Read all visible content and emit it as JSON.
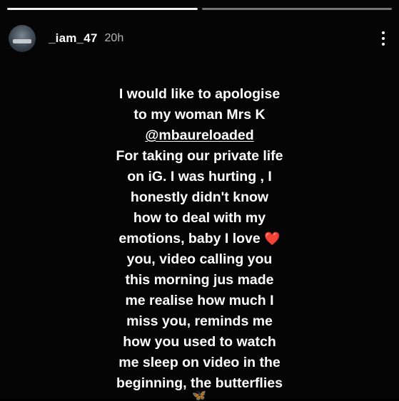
{
  "progress": {
    "segments": [
      {
        "fill": 1.0
      },
      {
        "fill": 0.0
      }
    ]
  },
  "header": {
    "username": "_iam_47",
    "time": "20h"
  },
  "caption": {
    "lines": [
      "I would like to apologise",
      "to my woman Mrs K",
      "@mbaureloaded",
      "For taking our private life",
      "on iG. I was hurting , I",
      "honestly didn't know",
      "how to deal with my",
      "emotions, baby I love",
      "you, video calling you",
      "this morning jus made",
      "me realise how much I",
      "miss you,  reminds me",
      "how you used to watch",
      "me sleep on video in the",
      "beginning, the butterflies"
    ],
    "heart": "❤️",
    "butterfly": "🦋"
  },
  "icons": {
    "menu": "more-vertical-icon",
    "heart": "heart-icon",
    "butterfly": "butterfly-icon"
  }
}
